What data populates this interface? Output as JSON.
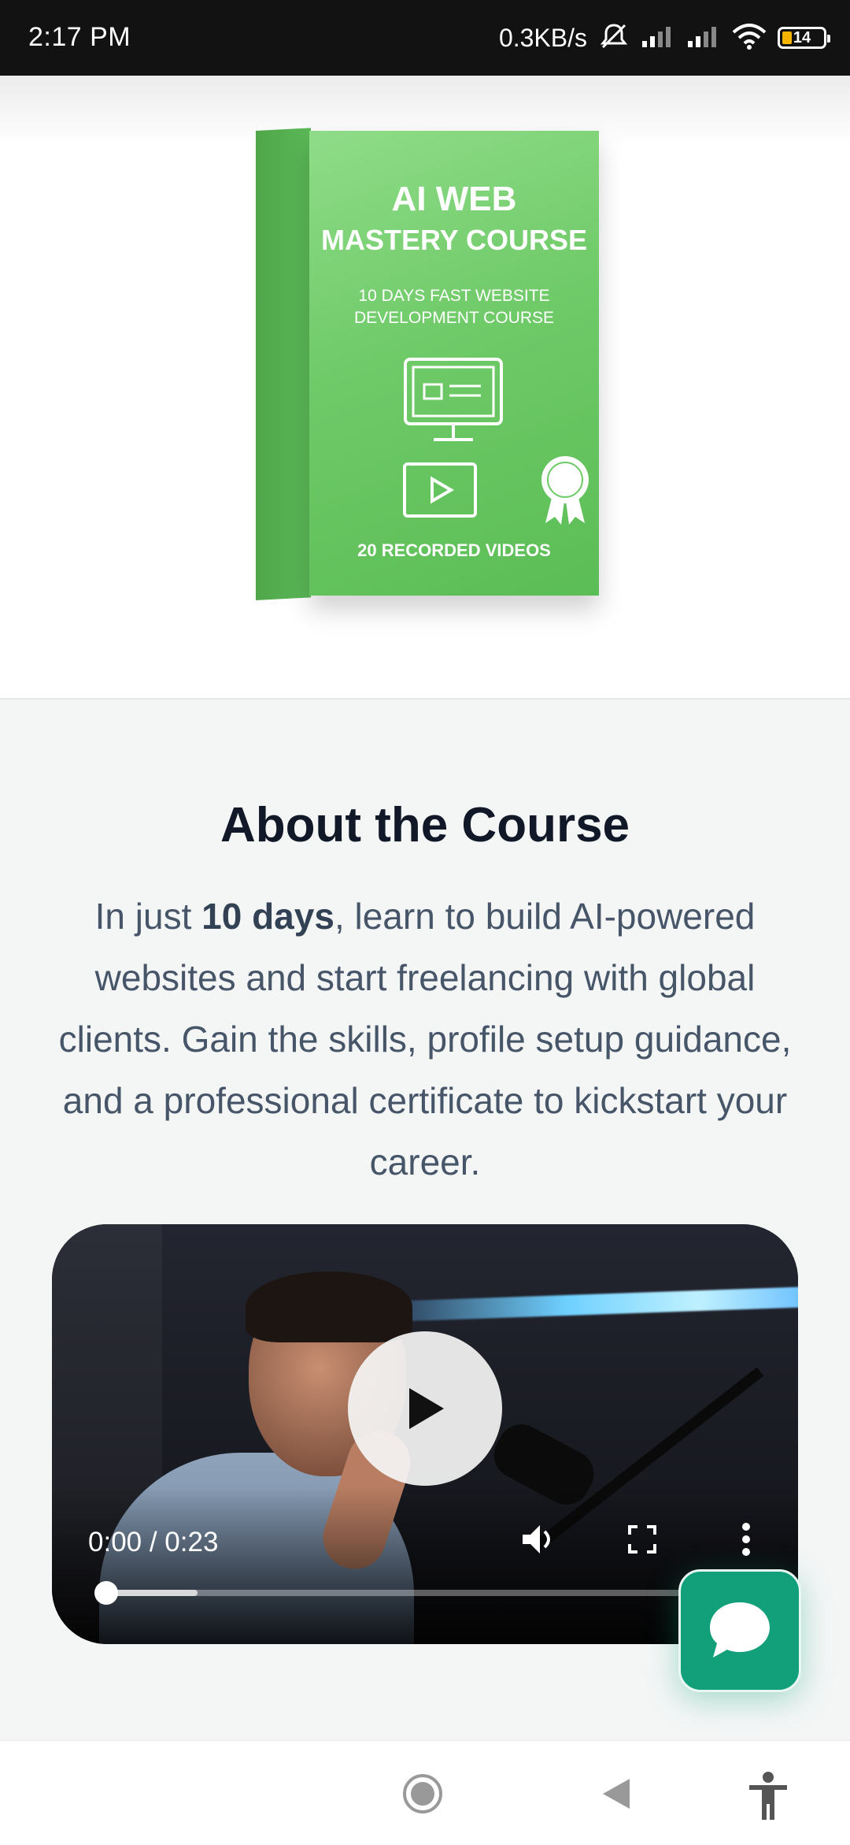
{
  "status_bar": {
    "time": "2:17 PM",
    "net_speed": "0.3KB/s",
    "battery": "14"
  },
  "product_box": {
    "title_line1": "AI WEB",
    "title_line2": "MASTERY COURSE",
    "subtitle_line1": "10 DAYS FAST WEBSITE",
    "subtitle_line2": "DEVELOPMENT COURSE",
    "badge_text": "CERTIFICATE",
    "footer": "20 RECORDED VIDEOS"
  },
  "about": {
    "title": "About the Course",
    "body_prefix": "In just ",
    "body_bold": "10 days",
    "body_suffix": ", learn to build AI-powered websites and start freelancing with global clients. Gain the skills, profile setup guidance, and a professional certificate to kickstart your career."
  },
  "video": {
    "time_display": "0:00 / 0:23",
    "progress_fraction": 0.0,
    "buffered_fraction": 0.15
  },
  "colors": {
    "accent_green": "#12a07a",
    "box_green": "#6fca68",
    "title_color": "#111827",
    "body_color": "#475569"
  }
}
